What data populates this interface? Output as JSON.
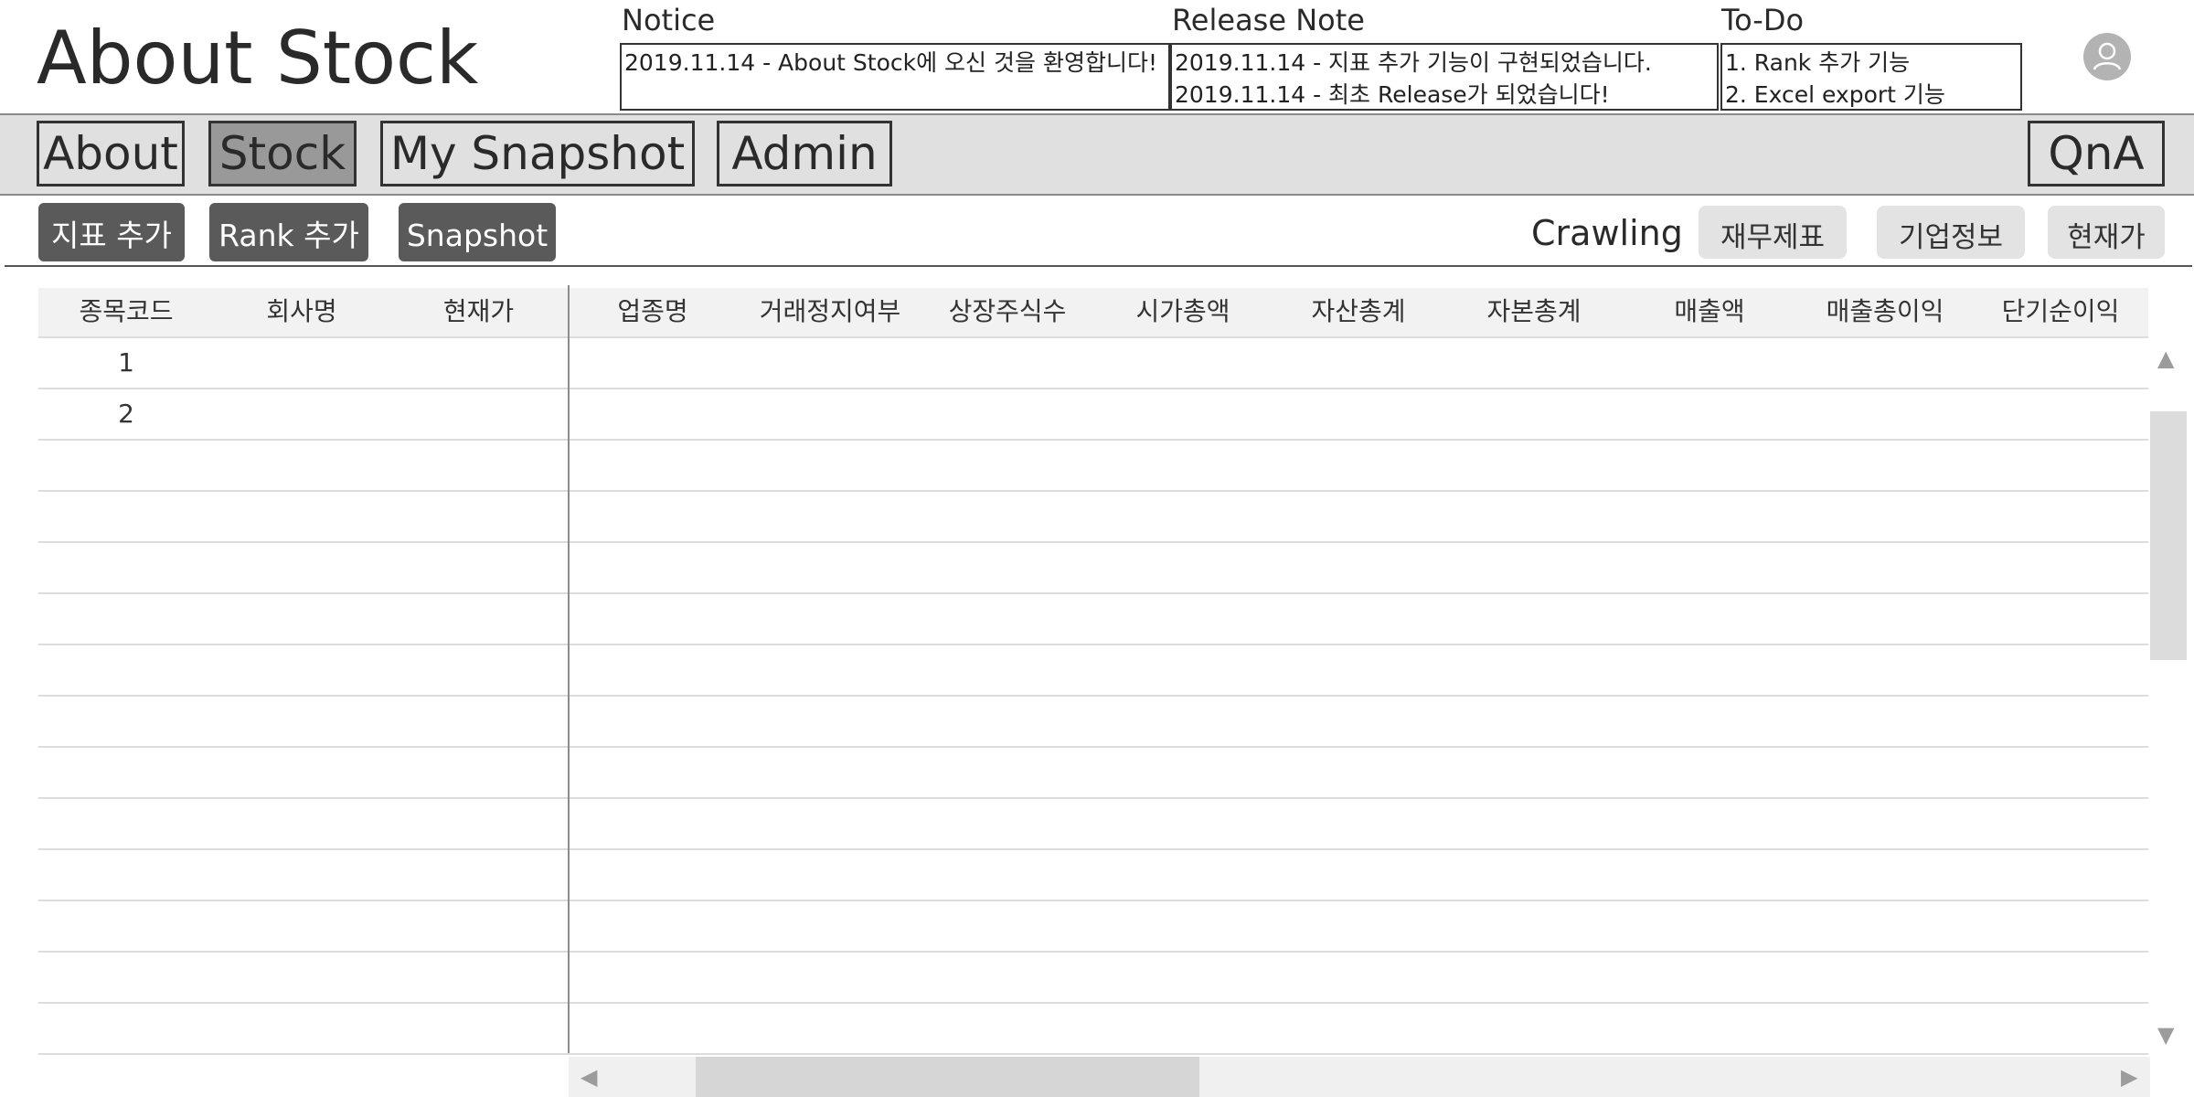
{
  "app": {
    "title": "About Stock"
  },
  "panels": {
    "notice": {
      "title": "Notice",
      "lines": [
        "2019.11.14 - About Stock에 오신 것을 환영합니다!"
      ]
    },
    "release_note": {
      "title": "Release Note",
      "lines": [
        "2019.11.14 - 지표 추가 기능이 구현되었습니다.",
        "2019.11.14 - 최초 Release가 되었습니다!"
      ]
    },
    "todo": {
      "title": "To-Do",
      "lines": [
        "1. Rank 추가 기능",
        "2. Excel export 기능"
      ]
    }
  },
  "header": {
    "avatar_icon": "user-avatar-icon"
  },
  "nav": {
    "tabs": [
      {
        "label": "About"
      },
      {
        "label": "Stock",
        "active": true
      },
      {
        "label": "My Snapshot"
      },
      {
        "label": "Admin"
      }
    ],
    "qna_label": "QnA"
  },
  "toolbar": {
    "buttons": [
      "지표 추가",
      "Rank 추가",
      "Snapshot"
    ],
    "crawling_label": "Crawling",
    "crawl_buttons": [
      "재무제표",
      "기업정보",
      "현재가"
    ]
  },
  "grid": {
    "frozen_columns": [
      "종목코드",
      "회사명",
      "현재가"
    ],
    "columns": [
      "업종명",
      "거래정지여부",
      "상장주식수",
      "시가총액",
      "자산총계",
      "자본총계",
      "매출액",
      "매출총이익",
      "단기순이익"
    ],
    "rows": [
      {
        "code": "1"
      },
      {
        "code": "2"
      }
    ]
  },
  "scrollbars": {
    "up_icon": "▲",
    "down_icon": "▼",
    "left_icon": "◀",
    "right_icon": "▶"
  },
  "colors": {
    "nav_band": "#e0e0e0",
    "active_tab": "#999999",
    "dark_button": "#5a5a5a",
    "light_button": "#e3e3e3",
    "avatar": "#b3b3b3"
  }
}
